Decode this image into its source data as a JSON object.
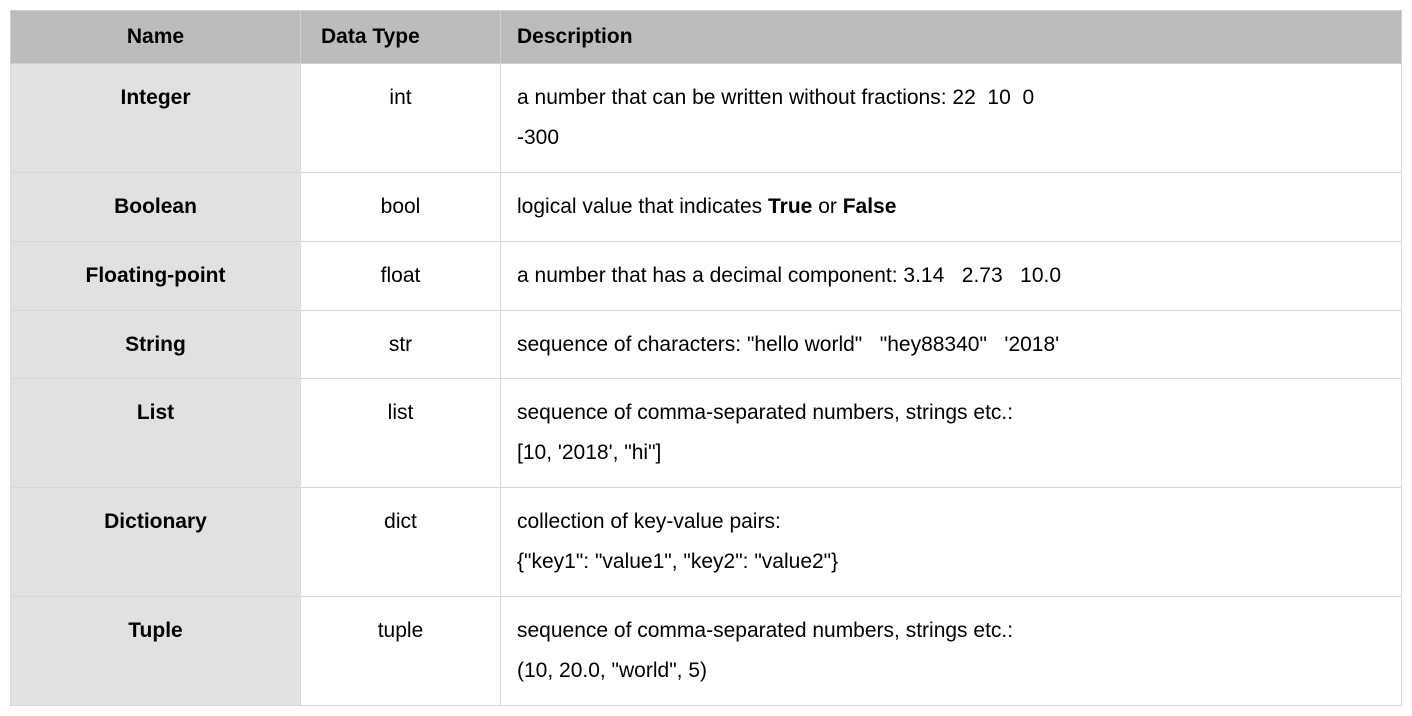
{
  "headers": {
    "name": "Name",
    "type": "Data Type",
    "desc": "Description"
  },
  "rows": [
    {
      "name": "Integer",
      "type": "int",
      "desc_html": "a number that can be written without fractions: 22  10  0 <br>-300"
    },
    {
      "name": "Boolean",
      "type": "bool",
      "desc_html": "logical value that indicates <span class=\"bold\">True</span> or <span class=\"bold\">False</span>"
    },
    {
      "name": "Floating-point",
      "type": "float",
      "desc_html": "a number that has a decimal component: 3.14   2.73   10.0"
    },
    {
      "name": "String",
      "type": "str",
      "desc_html": "sequence of characters: \"hello world\"   \"hey88340\"   '2018'"
    },
    {
      "name": "List",
      "type": "list",
      "desc_html": "sequence of comma-separated numbers, strings etc.:<br>[10, '2018', \"hi\"]"
    },
    {
      "name": "Dictionary",
      "type": "dict",
      "desc_html": "collection of key-value pairs:<br>{\"key1\": \"value1\", \"key2\": \"value2\"}"
    },
    {
      "name": "Tuple",
      "type": "tuple",
      "desc_html": "sequence of comma-separated numbers, strings etc.:<br>(10, 20.0, \"world\", 5)"
    }
  ]
}
